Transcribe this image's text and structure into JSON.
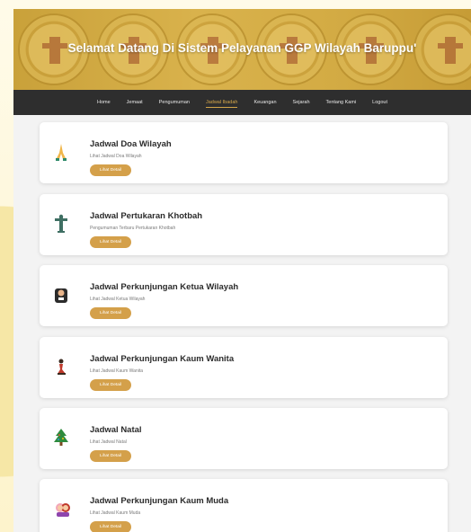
{
  "banner": {
    "title": "Selamat Datang Di Sistem Pelayanan GGP Wilayah Baruppu'"
  },
  "nav": {
    "items": [
      {
        "label": "Home",
        "active": false
      },
      {
        "label": "Jemaat",
        "active": false
      },
      {
        "label": "Pengumuman",
        "active": false
      },
      {
        "label": "Jadwal Ibadah",
        "active": true
      },
      {
        "label": "Keuangan",
        "active": false
      },
      {
        "label": "Sejarah",
        "active": false
      },
      {
        "label": "Tentang Kami",
        "active": false
      },
      {
        "label": "Logout",
        "active": false
      }
    ]
  },
  "cards": [
    {
      "icon": "praying-hands-icon",
      "title": "Jadwal Doa Wilayah",
      "subtitle": "Lihat Jadwal Doa Wilayah",
      "button": "Lihat Detail"
    },
    {
      "icon": "christ-statue-icon",
      "title": "Jadwal Pertukaran Khotbah",
      "subtitle": "Pengumuman Terbaru Pertukaran Khotbah",
      "button": "Lihat Detail"
    },
    {
      "icon": "pastor-icon",
      "title": "Jadwal Perkunjungan Ketua Wilayah",
      "subtitle": "Lihat Jadwal Ketua Wilayah",
      "button": "Lihat Detail"
    },
    {
      "icon": "kneeling-woman-icon",
      "title": "Jadwal Perkunjungan Kaum Wanita",
      "subtitle": "Lihat Jadwal Kaum Wanita",
      "button": "Lihat Detail"
    },
    {
      "icon": "christmas-tree-icon",
      "title": "Jadwal Natal",
      "subtitle": "Lihat Jadwal Natal",
      "button": "Lihat Detail"
    },
    {
      "icon": "youth-couple-icon",
      "title": "Jadwal Perkunjungan Kaum Muda",
      "subtitle": "Lihat Jadwal Kaum Muda",
      "button": "Lihat Detail"
    }
  ],
  "colors": {
    "accent": "#d4a04a",
    "navbar": "#2e2e2e",
    "banner": "#d3ab44"
  }
}
